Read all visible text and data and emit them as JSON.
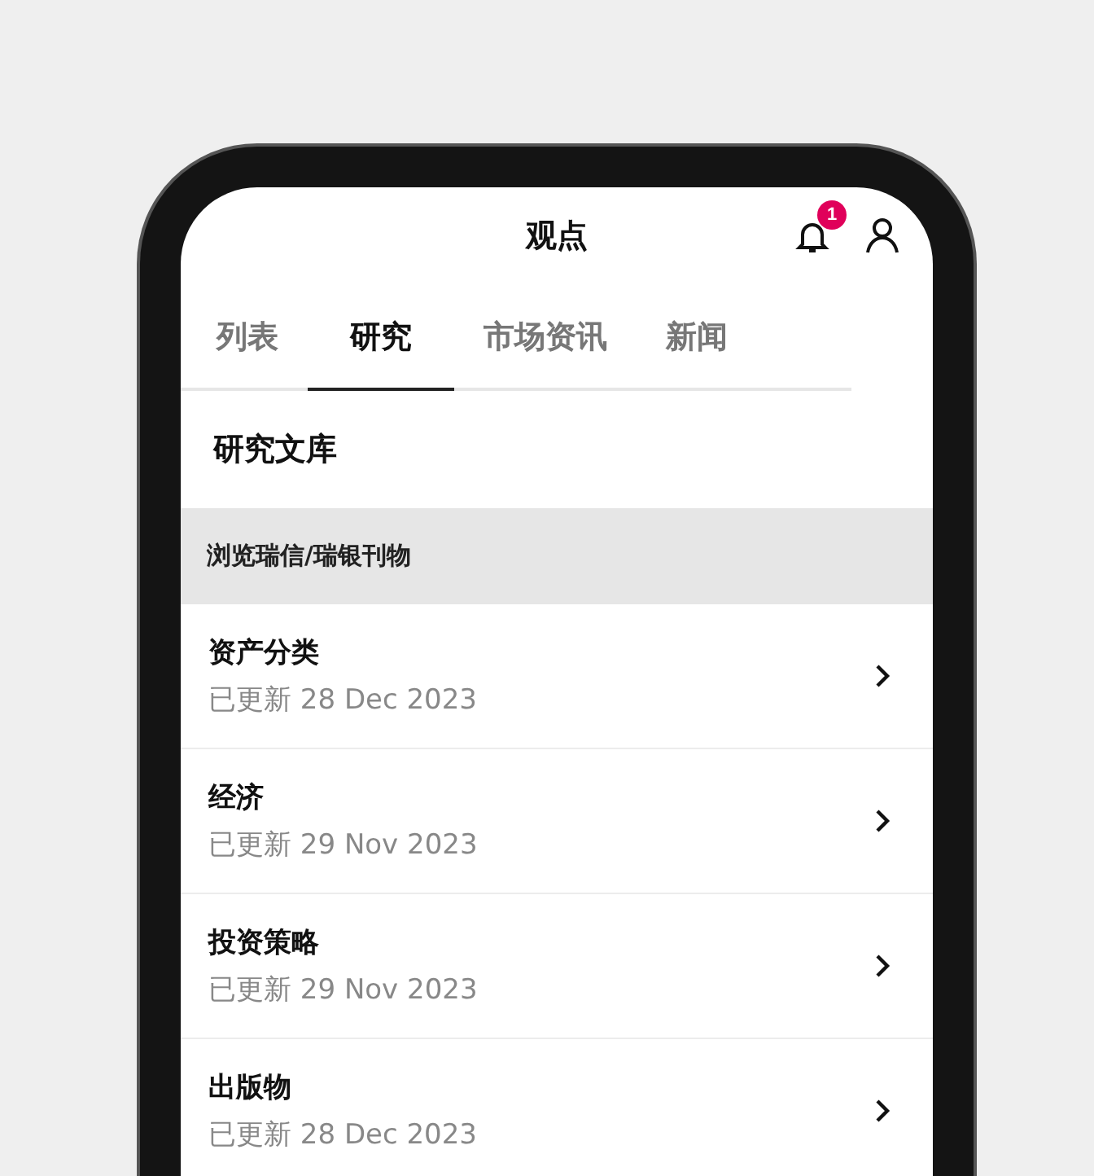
{
  "header": {
    "title": "观点",
    "notification_count": "1"
  },
  "tabs": [
    {
      "label": "列表",
      "selected": false
    },
    {
      "label": "研究",
      "selected": true
    },
    {
      "label": "市场资讯",
      "selected": false
    },
    {
      "label": "新闻",
      "selected": false
    }
  ],
  "section_title": "研究文库",
  "group_header": "浏览瑞信/瑞银刊物",
  "items": [
    {
      "title": "资产分类",
      "updated": "已更新 28 Dec 2023"
    },
    {
      "title": "经济",
      "updated": "已更新 29 Nov 2023"
    },
    {
      "title": "投资策略",
      "updated": "已更新 29 Nov 2023"
    },
    {
      "title": "出版物",
      "updated": "已更新 28 Dec 2023"
    }
  ]
}
